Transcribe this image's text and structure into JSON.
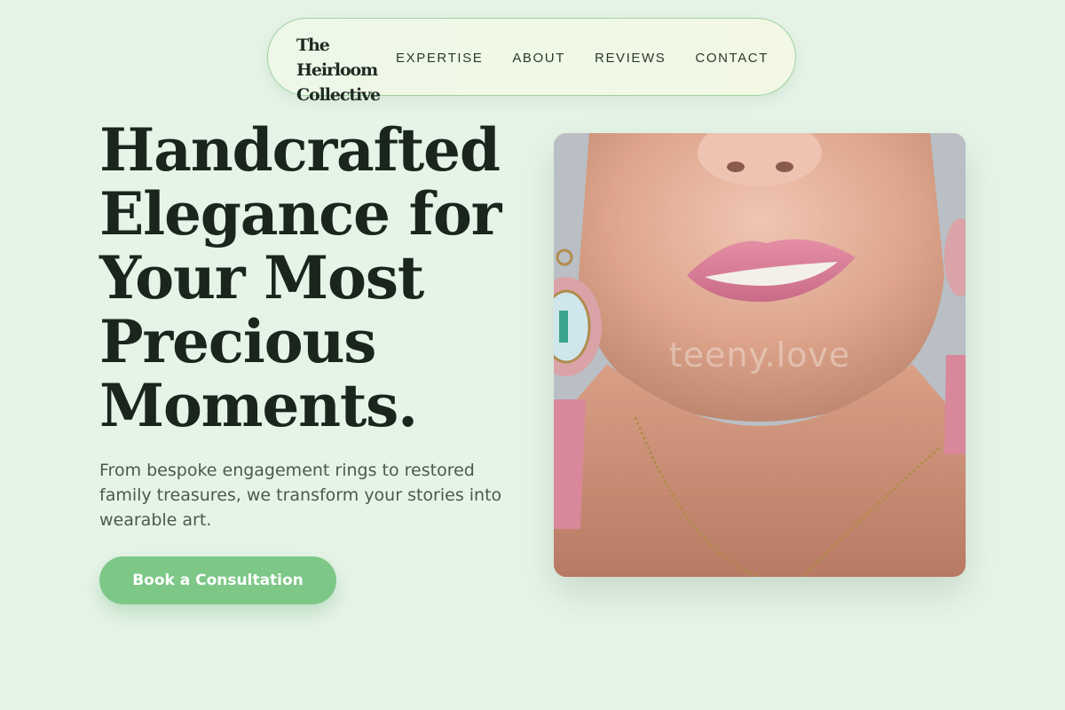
{
  "brand": {
    "name": "The Heirloom Collective"
  },
  "nav": {
    "items": [
      {
        "label": "EXPERTISE"
      },
      {
        "label": "ABOUT"
      },
      {
        "label": "REVIEWS"
      },
      {
        "label": "CONTACT"
      }
    ]
  },
  "hero": {
    "title": "Handcrafted Elegance for Your Most Precious Moments.",
    "subtitle": "From bespoke engagement rings to restored family treasures, we transform your stories into wearable art.",
    "cta_label": "Book a Consultation",
    "image_watermark": "teeny.love"
  },
  "colors": {
    "background": "#e6f4e8",
    "accent": "#7dc787",
    "heading": "#1a261d",
    "nav_border": "#9dd29f"
  }
}
